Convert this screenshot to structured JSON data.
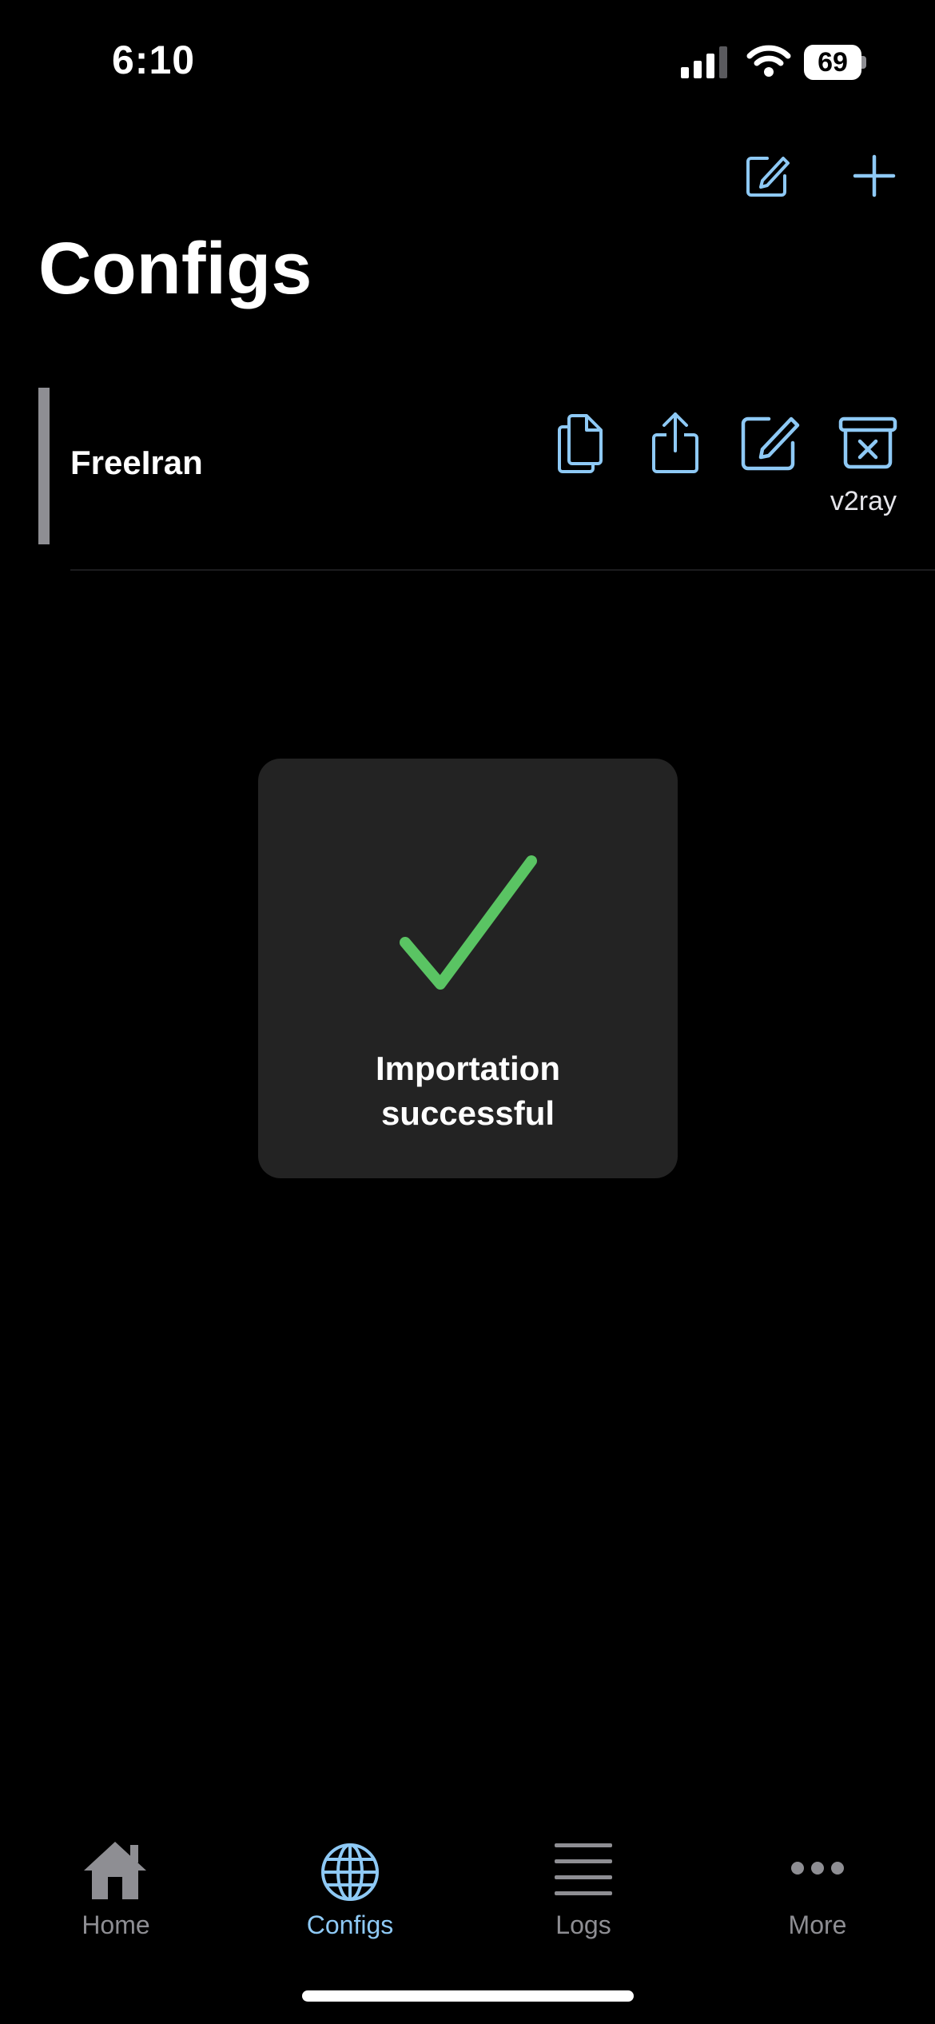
{
  "status_bar": {
    "time": "6:10",
    "battery": "69"
  },
  "nav": {
    "title": "Configs",
    "edit_icon": "square-and-pencil-icon",
    "add_icon": "plus-icon"
  },
  "configs": [
    {
      "name": "FreeIran",
      "type": "v2ray",
      "actions": [
        "copy-icon",
        "share-icon",
        "edit-icon",
        "delete-icon"
      ]
    }
  ],
  "toast": {
    "icon": "checkmark-icon",
    "message": "Importation\nsuccessful"
  },
  "tab_bar": {
    "tabs": [
      {
        "label": "Home",
        "icon": "house-icon",
        "selected": false
      },
      {
        "label": "Configs",
        "icon": "globe-icon",
        "selected": true
      },
      {
        "label": "Logs",
        "icon": "lines-icon",
        "selected": false
      },
      {
        "label": "More",
        "icon": "ellipsis-icon",
        "selected": false
      }
    ]
  },
  "colors": {
    "accent": "#8ec9f5",
    "inactive": "#8e8e93",
    "success": "#5ac463",
    "background": "#000000",
    "toast_bg": "#232323"
  }
}
